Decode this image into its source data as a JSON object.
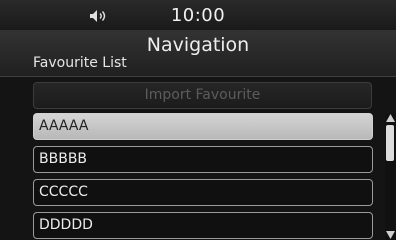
{
  "status": {
    "time": "10:00",
    "volume_icon": "volume-icon"
  },
  "header": {
    "title": "Navigation",
    "section_label": "Favourite List"
  },
  "import_button": {
    "label": "Import Favourite",
    "enabled": false
  },
  "favourites": [
    {
      "label": "AAAAA",
      "selected": true
    },
    {
      "label": "BBBBB",
      "selected": false
    },
    {
      "label": "CCCCC",
      "selected": false
    },
    {
      "label": "DDDDD",
      "selected": false
    }
  ],
  "scrollbar": {
    "up_icon": "chevron-up-icon",
    "down_icon": "chevron-down-icon"
  },
  "colors": {
    "background": "#000000",
    "item_border": "#9a9a9a",
    "selected_fill": "#c8c8c8",
    "disabled_text": "#5c5c5c"
  }
}
